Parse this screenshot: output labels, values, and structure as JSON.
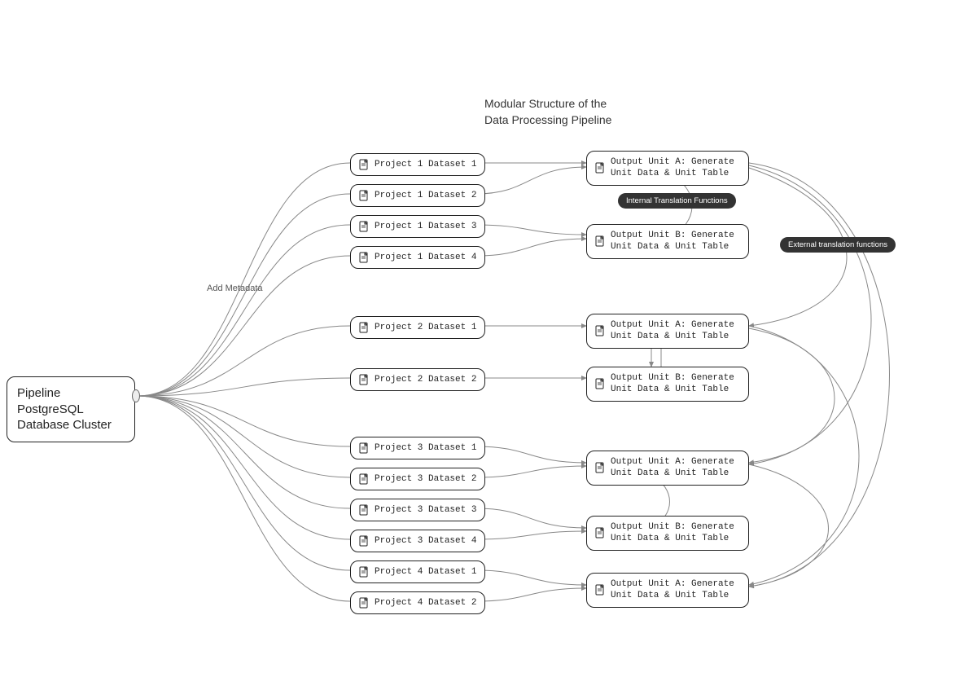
{
  "title_line1": "Modular Structure of the",
  "title_line2": "Data Processing Pipeline",
  "db_node": "Pipeline PostgreSQL Database Cluster",
  "metadata_label": "Add Metadata",
  "datasets": {
    "p1d1": "Project 1 Dataset 1",
    "p1d2": "Project 1 Dataset 2",
    "p1d3": "Project 1 Dataset 3",
    "p1d4": "Project 1 Dataset 4",
    "p2d1": "Project 2 Dataset 1",
    "p2d2": "Project 2 Dataset 2",
    "p3d1": "Project 3 Dataset 1",
    "p3d2": "Project 3 Dataset 2",
    "p3d3": "Project 3 Dataset 3",
    "p3d4": "Project 3 Dataset 4",
    "p4d1": "Project 4 Dataset 1",
    "p4d2": "Project 4 Dataset 2"
  },
  "outputs": {
    "p1a": "Output Unit A: Generate Unit Data & Unit Table",
    "p1b": "Output Unit B: Generate Unit Data & Unit Table",
    "p2a": "Output Unit A: Generate Unit Data & Unit Table",
    "p2b": "Output Unit B: Generate Unit Data & Unit Table",
    "p3a": "Output Unit A: Generate Unit Data & Unit Table",
    "p3b": "Output Unit B: Generate Unit Data & Unit Table",
    "p4a": "Output Unit A: Generate Unit Data & Unit Table"
  },
  "pills": {
    "internal": "Internal Translation Functions",
    "external": "External translation functions"
  }
}
